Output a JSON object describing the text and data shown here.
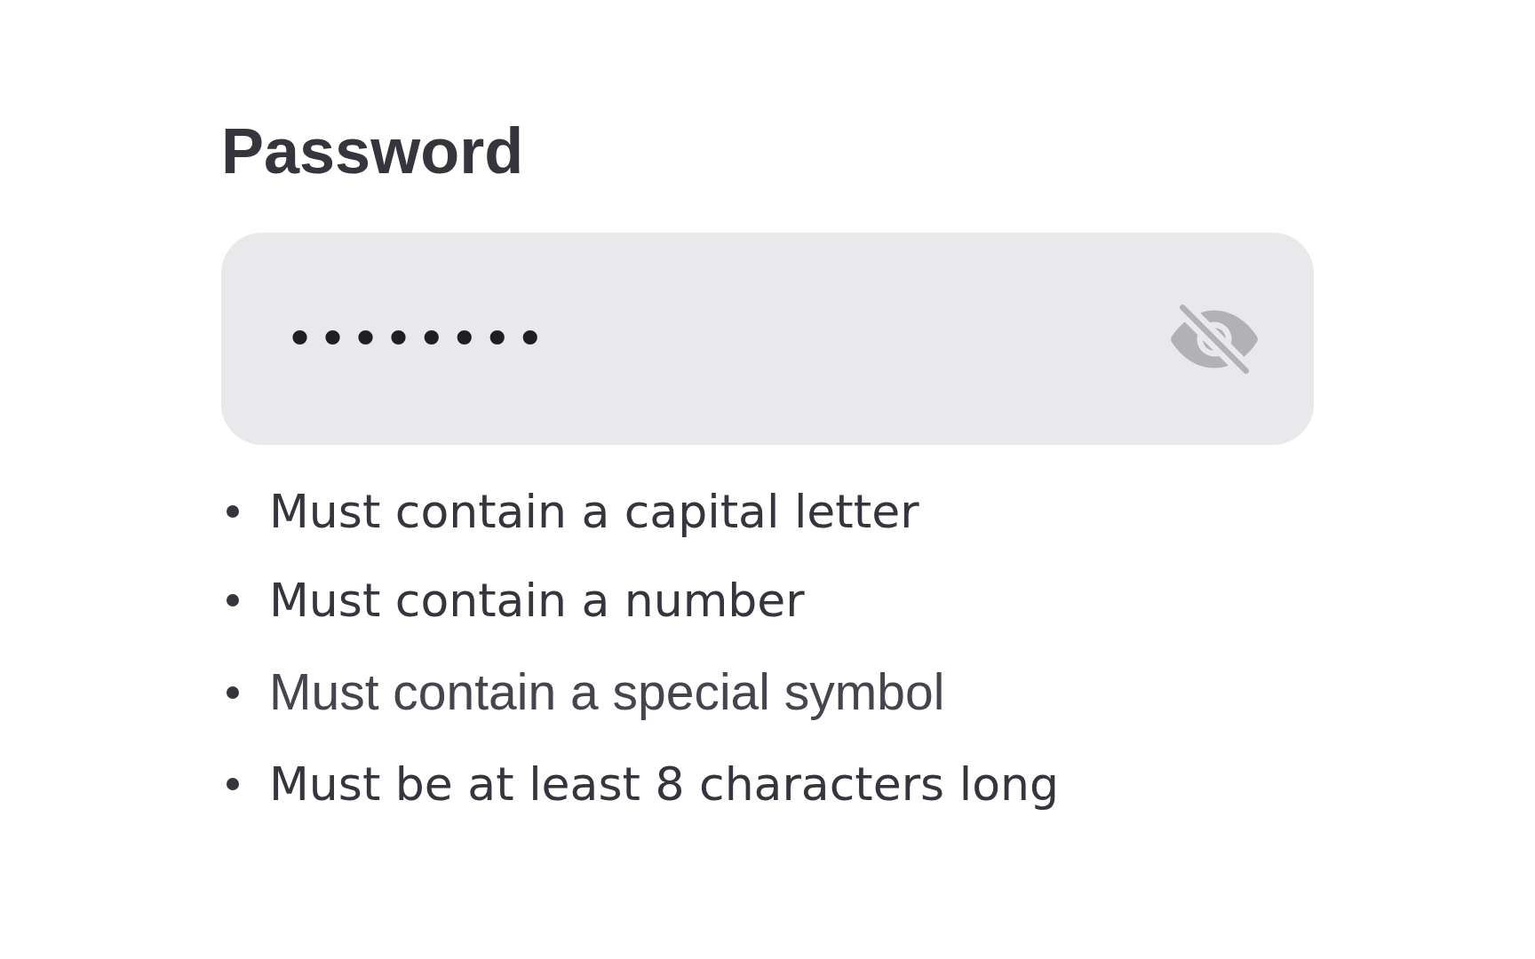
{
  "label": "Password",
  "field": {
    "value": "••••••••",
    "masked": true
  },
  "rules": [
    {
      "text": "Must contain a capital letter",
      "met": true
    },
    {
      "text": "Must contain a number",
      "met": true
    },
    {
      "text": "Must contain a special symbol",
      "met": false
    },
    {
      "text": "Must be at least 8 characters long",
      "met": true
    }
  ]
}
